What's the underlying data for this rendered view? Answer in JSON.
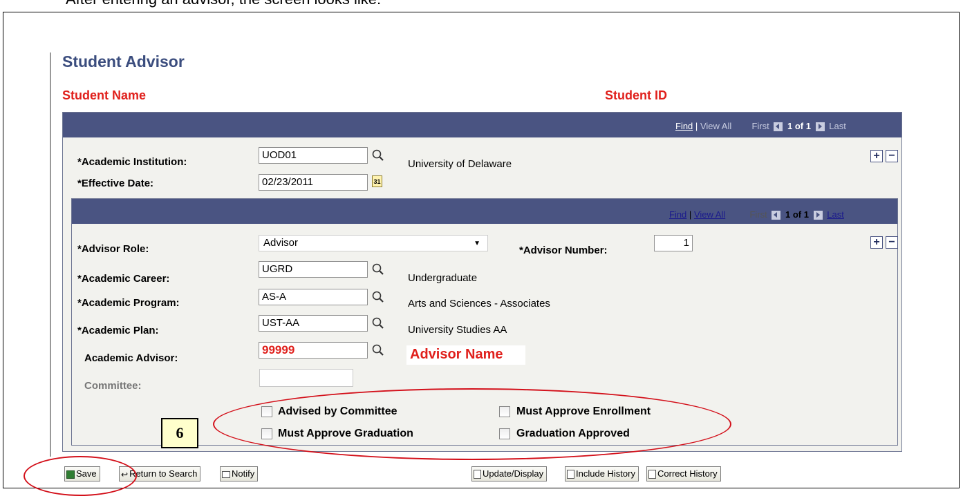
{
  "caption": "After entering an advisor, the screen looks like:",
  "page_title": "Student Advisor",
  "student_name_label": "Student Name",
  "student_id_label": "Student ID",
  "outer_nav": {
    "find": "Find",
    "sep": "|",
    "view_all": "View All",
    "first": "First",
    "count": "1 of 1",
    "last": "Last"
  },
  "inner_nav": {
    "find": "Find",
    "sep": "|",
    "view_all": "View All",
    "first": "First",
    "count": "1 of 1",
    "last": "Last"
  },
  "institution": {
    "label": "*Academic Institution:",
    "value": "UOD01",
    "desc": "University of Delaware"
  },
  "effective_date": {
    "label": "*Effective Date:",
    "value": "02/23/2011",
    "calendar_icon_text": "31"
  },
  "advisor_role": {
    "label": "*Advisor Role:",
    "value": "Advisor"
  },
  "advisor_number": {
    "label": "*Advisor Number:",
    "value": "1"
  },
  "career": {
    "label": "*Academic Career:",
    "value": "UGRD",
    "desc": "Undergraduate"
  },
  "program": {
    "label": "*Academic Program:",
    "value": "AS-A",
    "desc": "Arts and Sciences - Associates"
  },
  "plan": {
    "label": "*Academic Plan:",
    "value": "UST-AA",
    "desc": "University Studies AA"
  },
  "advisor": {
    "label": "Academic Advisor:",
    "value": "99999",
    "desc": "Advisor Name"
  },
  "committee": {
    "label": "Committee:",
    "value": ""
  },
  "checkboxes": {
    "advised_by_committee": "Advised by Committee",
    "must_approve_enrollment": "Must Approve Enrollment",
    "must_approve_graduation": "Must Approve Graduation",
    "graduation_approved": "Graduation Approved"
  },
  "row_buttons": {
    "add": "+",
    "delete": "−"
  },
  "callout_number": "6",
  "toolbar": {
    "save": "Save",
    "return_to_search": "Return to Search",
    "notify": "Notify",
    "update_display": "Update/Display",
    "include_history": "Include History",
    "correct_history": "Correct History"
  },
  "colors": {
    "title": "#3b4d7e",
    "header_bar": "#4a5482",
    "highlight_red": "#e0201c",
    "panel_bg": "#f2f2ee"
  }
}
